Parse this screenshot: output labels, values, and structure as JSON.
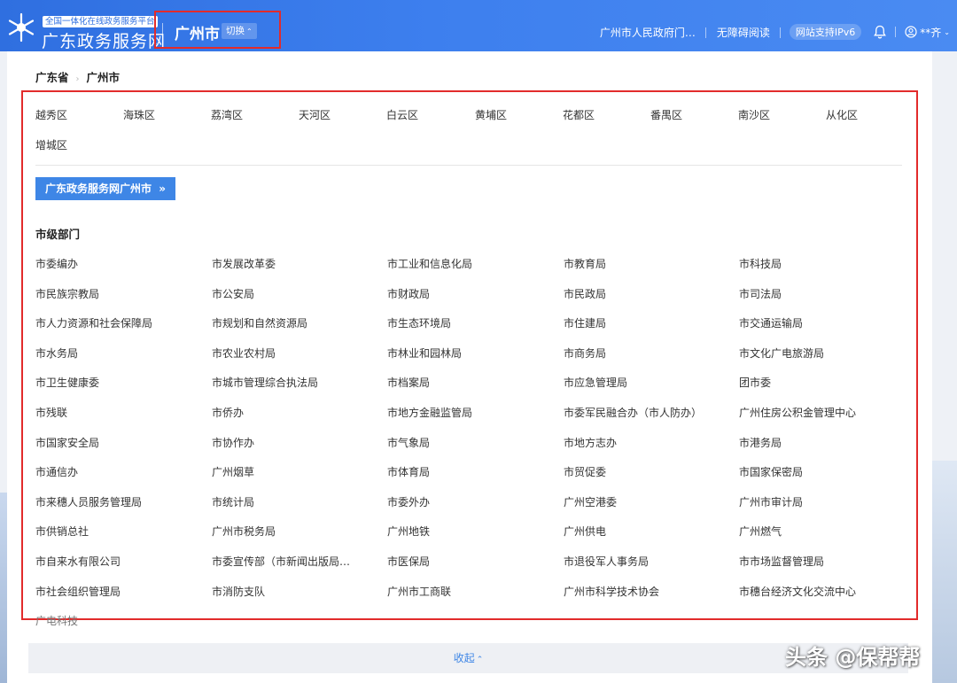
{
  "header": {
    "logo_sub": "全国一体化在线政务服务平台",
    "logo_main": "广东政务服务网",
    "city": "广州市",
    "switch_label": "切换",
    "links": [
      "广州市人民政府门…",
      "无障碍阅读",
      "网站支持IPv6"
    ],
    "user": "**齐"
  },
  "breadcrumb": [
    "广东省",
    "广州市"
  ],
  "districts": [
    "越秀区",
    "海珠区",
    "荔湾区",
    "天河区",
    "白云区",
    "黄埔区",
    "花都区",
    "番禺区",
    "南沙区",
    "从化区",
    "增城区"
  ],
  "portal_button": "广东政务服务网广州市",
  "section_title": "市级部门",
  "departments": [
    "市委编办",
    "市发展改革委",
    "市工业和信息化局",
    "市教育局",
    "市科技局",
    "市民族宗教局",
    "市公安局",
    "市财政局",
    "市民政局",
    "市司法局",
    "市人力资源和社会保障局",
    "市规划和自然资源局",
    "市生态环境局",
    "市住建局",
    "市交通运输局",
    "市水务局",
    "市农业农村局",
    "市林业和园林局",
    "市商务局",
    "市文化广电旅游局",
    "市卫生健康委",
    "市城市管理综合执法局",
    "市档案局",
    "市应急管理局",
    "团市委",
    "市残联",
    "市侨办",
    "市地方金融监管局",
    "市委军民融合办（市人防办）",
    "广州住房公积金管理中心",
    "市国家安全局",
    "市协作办",
    "市气象局",
    "市地方志办",
    "市港务局",
    "市通信办",
    "广州烟草",
    "市体育局",
    "市贸促委",
    "市国家保密局",
    "市来穗人员服务管理局",
    "市统计局",
    "市委外办",
    "广州空港委",
    "广州市审计局",
    "市供销总社",
    "广州市税务局",
    "广州地铁",
    "广州供电",
    "广州燃气",
    "市自来水有限公司",
    "市委宣传部（市新闻出版局…",
    "市医保局",
    "市退役军人事务局",
    "市市场监督管理局",
    "市社会组织管理局",
    "市消防支队",
    "广州市工商联",
    "广州市科学技术协会",
    "市穗台经济文化交流中心",
    "广电科技"
  ],
  "collapse_label": "收起",
  "watermark": "头条 @保帮帮",
  "icons": {
    "logo": "snowflake-star-icon",
    "bell": "bell-icon",
    "user": "user-circle-icon",
    "chevron": "chevron-up-icon",
    "double_arrow": "double-chevron-right-icon"
  },
  "colors": {
    "header": "#3d7fee",
    "accent": "#3e86e6",
    "highlight": "#e22b2b"
  }
}
